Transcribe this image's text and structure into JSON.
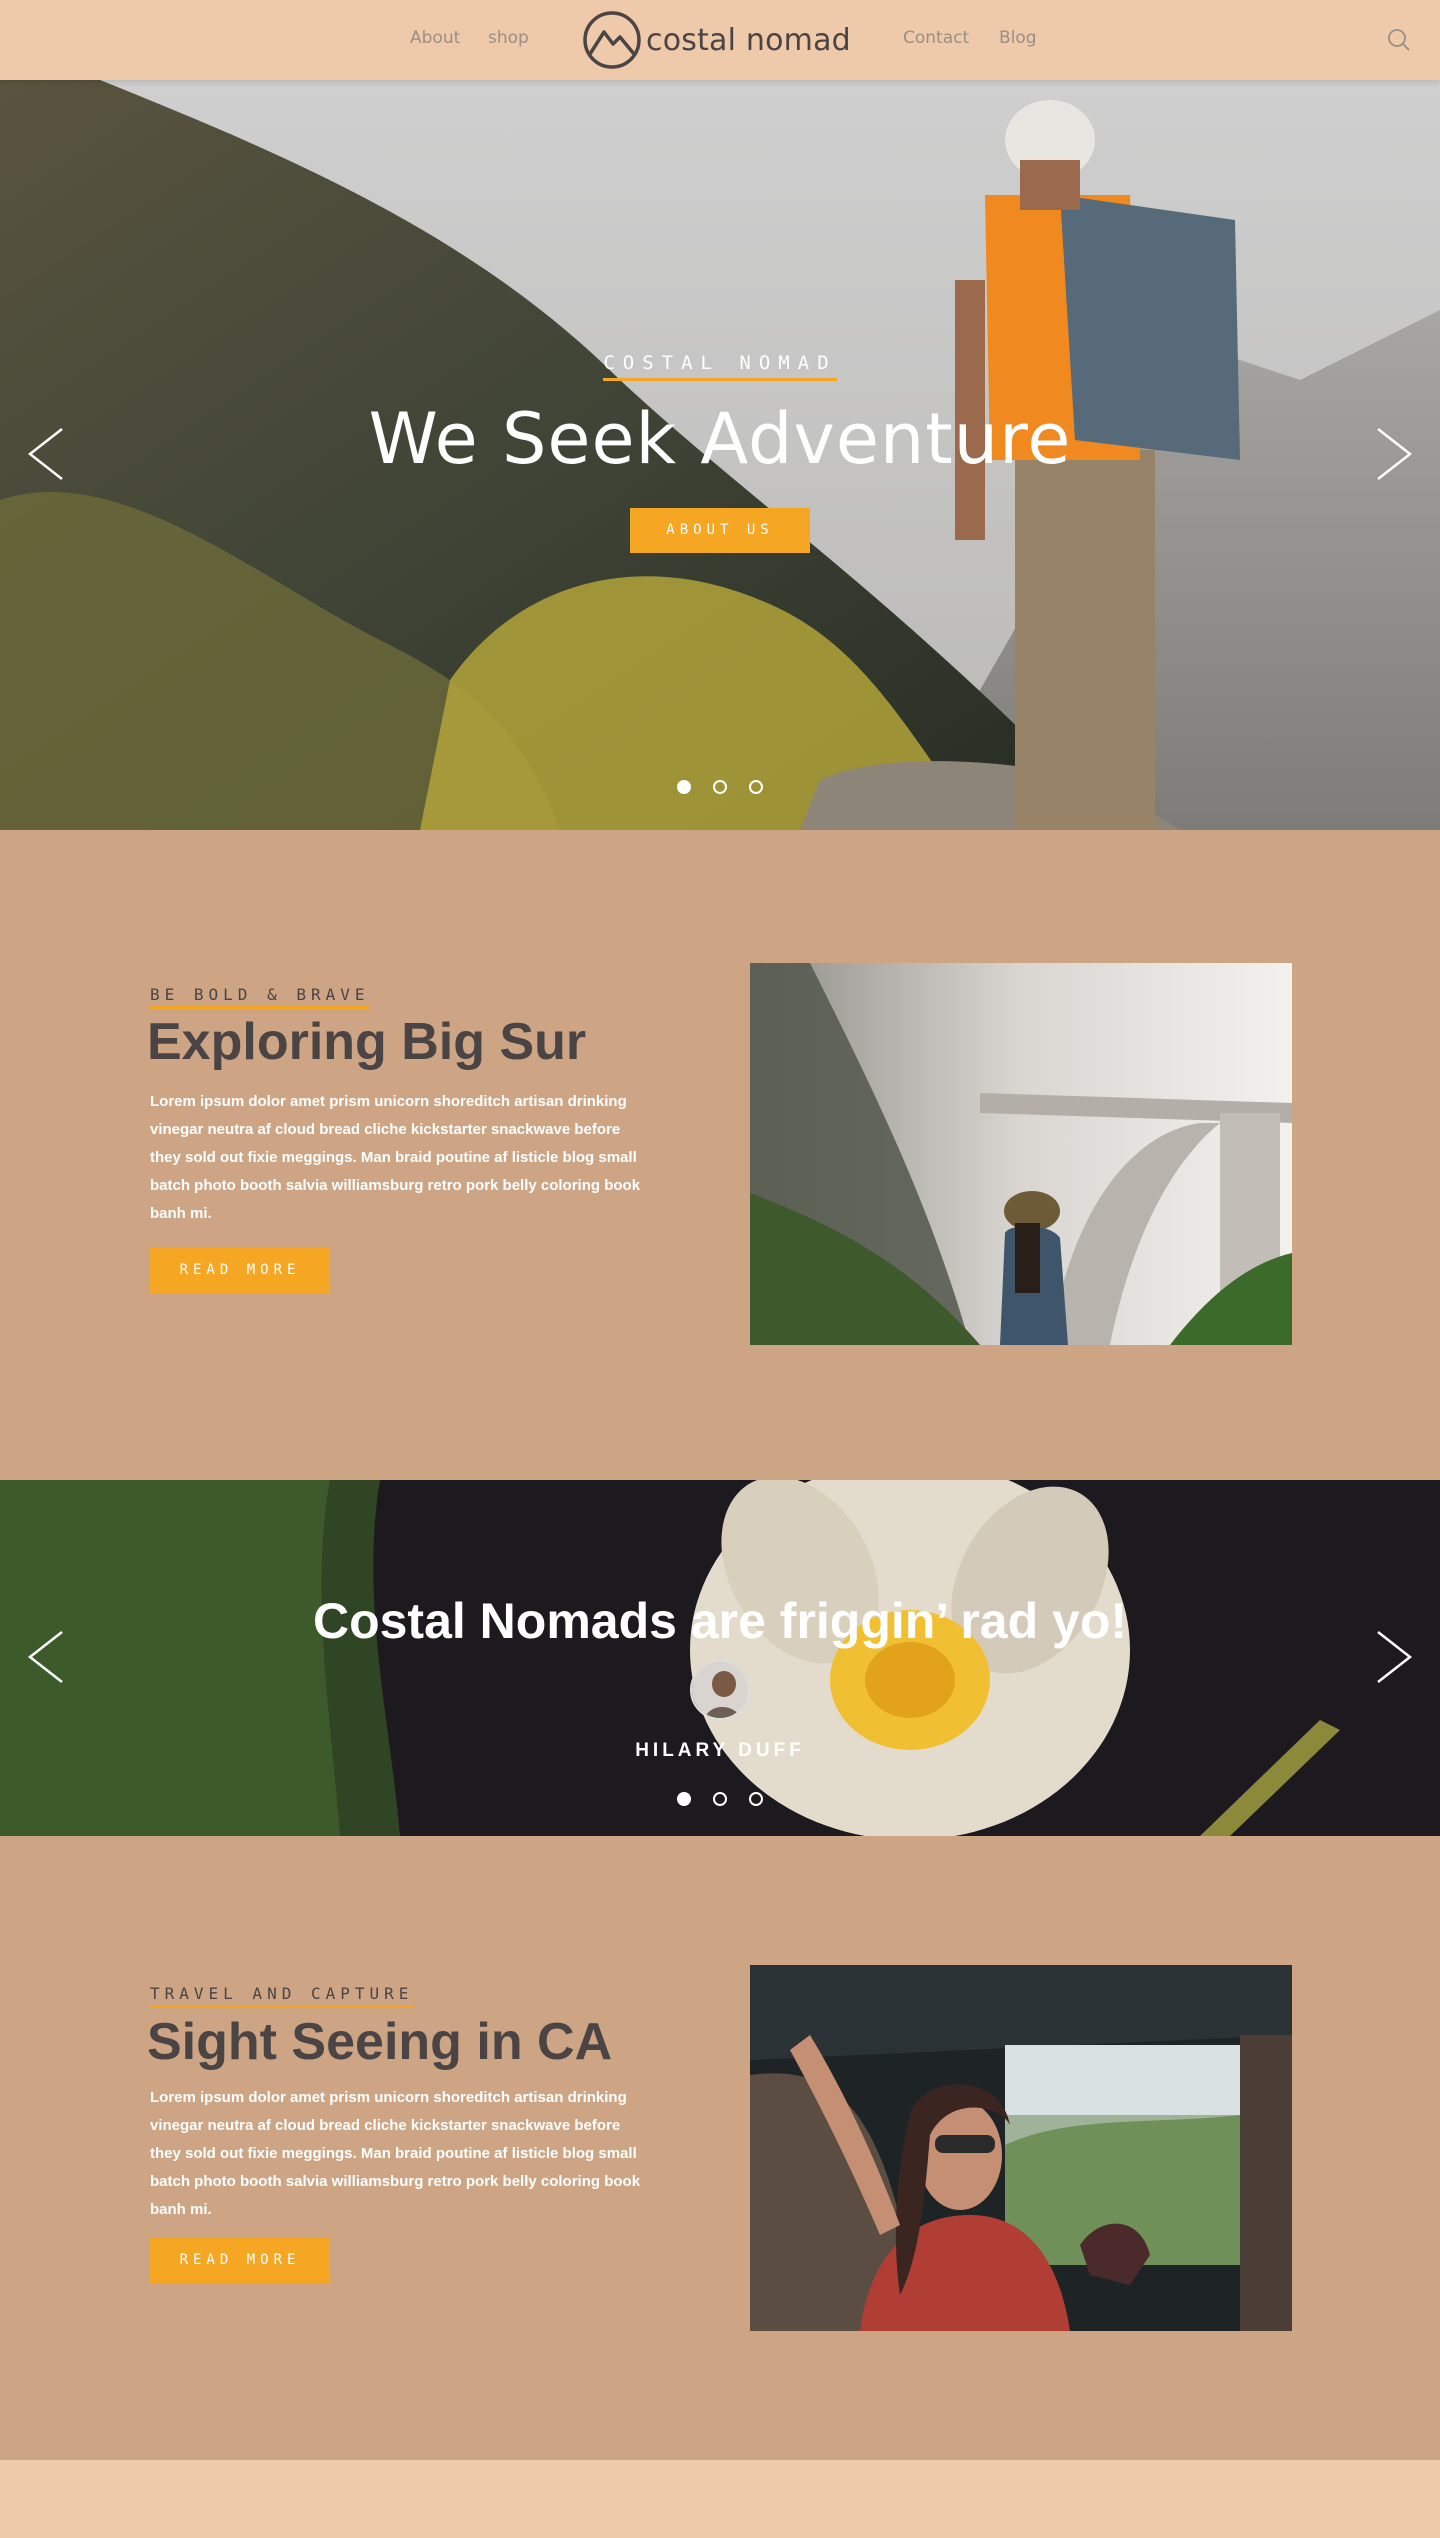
{
  "nav": {
    "left_links": [
      "About",
      "shop"
    ],
    "right_links": [
      "Contact",
      "Blog"
    ],
    "logo_text": "costal nomad",
    "logo_icon": "mountain-circle-icon",
    "search_icon": "search-icon"
  },
  "hero": {
    "kicker": "COSTAL NOMAD",
    "title": "We Seek Adventure",
    "button": "ABOUT US",
    "slide_count": 3,
    "active_slide": 1
  },
  "feature1": {
    "eyebrow": "BE BOLD & BRAVE",
    "title": "Exploring Big Sur",
    "body": "Lorem ipsum dolor amet prism unicorn shoreditch artisan drinking vinegar neutra af cloud bread cliche kickstarter snackwave before they sold out fixie meggings. Man braid poutine af listicle blog small batch photo booth salvia williamsburg retro pork belly coloring book banh mi.",
    "button": "READ MORE"
  },
  "testimonial": {
    "quote": "Costal Nomads are friggin’ rad yo!",
    "name": "HILARY DUFF",
    "slide_count": 3,
    "active_slide": 1
  },
  "feature2": {
    "eyebrow": "TRAVEL AND CAPTURE",
    "title": "Sight Seeing in CA",
    "body": "Lorem ipsum dolor amet prism unicorn shoreditch artisan drinking vinegar neutra af cloud bread cliche kickstarter snackwave before they sold out fixie meggings. Man braid poutine af listicle blog small batch photo booth salvia williamsburg retro pork belly coloring book banh mi.",
    "button": "READ MORE"
  },
  "colors": {
    "nav_bg": "#eecaaa",
    "page_bg": "#cda585",
    "accent": "#f5a623",
    "heading": "#4a4444"
  }
}
